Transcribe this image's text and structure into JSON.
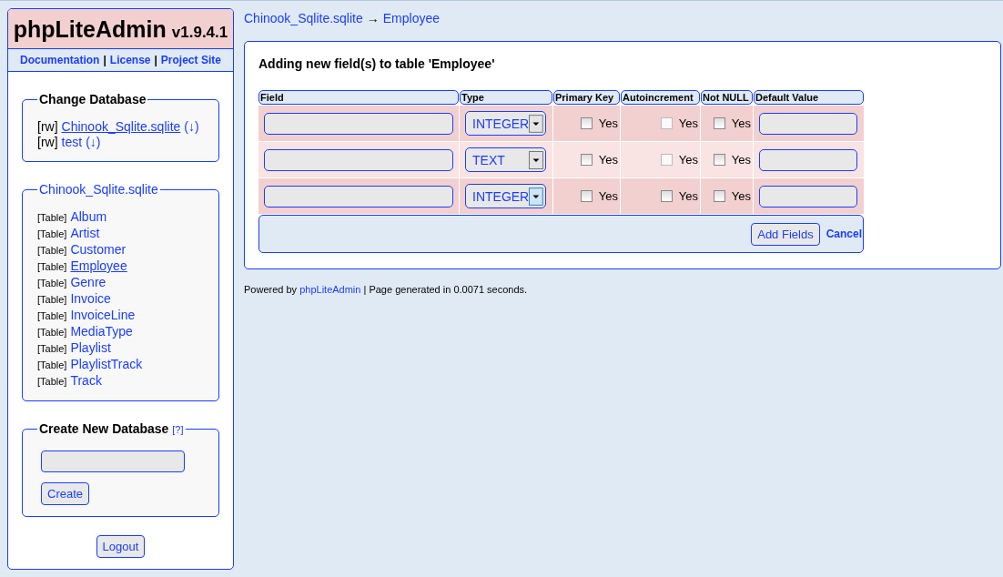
{
  "header": {
    "title": "phpLiteAdmin",
    "version": "v1.9.4.1",
    "links": [
      "Documentation",
      "License",
      "Project Site"
    ],
    "separator": "|"
  },
  "change_database": {
    "legend": "Change Database",
    "items": [
      {
        "mode": "[rw]",
        "name": "Chinook_Sqlite.sqlite",
        "selected": true,
        "download": "(↓)"
      },
      {
        "mode": "[rw]",
        "name": "test",
        "selected": false,
        "download": "(↓)"
      }
    ]
  },
  "table_list": {
    "legend": "Chinook_Sqlite.sqlite",
    "items": [
      {
        "tag": "[Table]",
        "name": "Album",
        "selected": false
      },
      {
        "tag": "[Table]",
        "name": "Artist",
        "selected": false
      },
      {
        "tag": "[Table]",
        "name": "Customer",
        "selected": false
      },
      {
        "tag": "[Table]",
        "name": "Employee",
        "selected": true
      },
      {
        "tag": "[Table]",
        "name": "Genre",
        "selected": false
      },
      {
        "tag": "[Table]",
        "name": "Invoice",
        "selected": false
      },
      {
        "tag": "[Table]",
        "name": "InvoiceLine",
        "selected": false
      },
      {
        "tag": "[Table]",
        "name": "MediaType",
        "selected": false
      },
      {
        "tag": "[Table]",
        "name": "Playlist",
        "selected": false
      },
      {
        "tag": "[Table]",
        "name": "PlaylistTrack",
        "selected": false
      },
      {
        "tag": "[Table]",
        "name": "Track",
        "selected": false
      }
    ]
  },
  "create_database": {
    "legend": "Create New Database",
    "help": "[?]",
    "button": "Create"
  },
  "logout": "Logout",
  "breadcrumb": {
    "database": "Chinook_Sqlite.sqlite",
    "arrow": "→",
    "table": "Employee"
  },
  "form": {
    "title": "Adding new field(s) to table 'Employee'",
    "columns": [
      "Field",
      "Type",
      "Primary Key",
      "Autoincrement",
      "Not NULL",
      "Default Value"
    ],
    "rows": [
      {
        "type": "INTEGER",
        "primary_key": {
          "checked": false,
          "disabled": false,
          "label": "Yes"
        },
        "autoincrement": {
          "checked": false,
          "disabled": true,
          "label": "Yes"
        },
        "not_null": {
          "checked": false,
          "disabled": false,
          "label": "Yes"
        }
      },
      {
        "type": "TEXT",
        "primary_key": {
          "checked": false,
          "disabled": false,
          "label": "Yes"
        },
        "autoincrement": {
          "checked": false,
          "disabled": true,
          "label": "Yes"
        },
        "not_null": {
          "checked": false,
          "disabled": false,
          "label": "Yes"
        }
      },
      {
        "type": "INTEGER",
        "primary_key": {
          "checked": false,
          "disabled": false,
          "label": "Yes"
        },
        "autoincrement": {
          "checked": false,
          "disabled": false,
          "label": "Yes"
        },
        "not_null": {
          "checked": false,
          "disabled": false,
          "label": "Yes"
        }
      }
    ],
    "add_button": "Add Fields",
    "cancel": "Cancel"
  },
  "footer": {
    "prefix": "Powered by",
    "link": "phpLiteAdmin",
    "suffix": "| Page generated in 0.0071 seconds."
  }
}
